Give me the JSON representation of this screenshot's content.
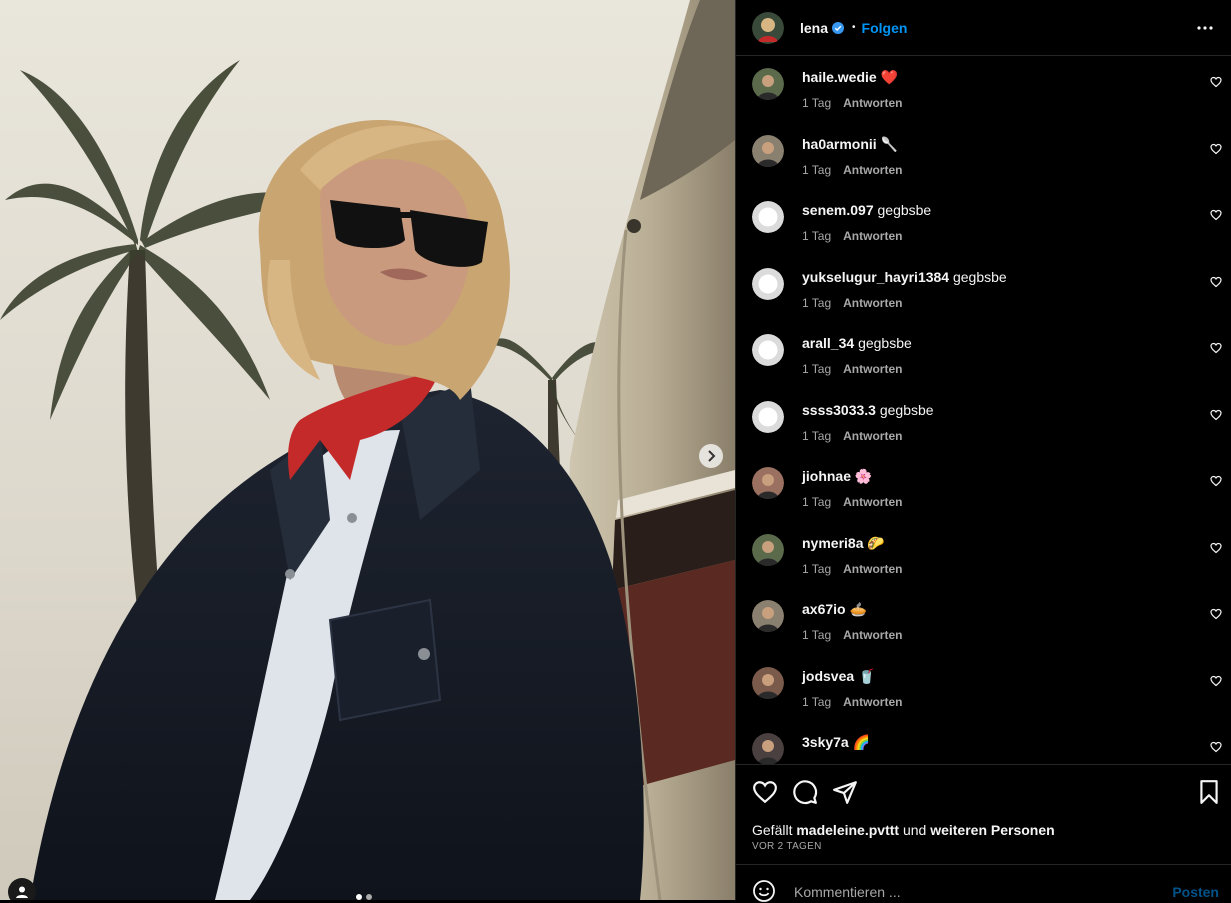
{
  "post": {
    "username": "lena",
    "separator": "•",
    "follow_label": "Folgen",
    "photo_alt": "",
    "verified_color": "#3897f0"
  },
  "comments": [
    {
      "user": "haile.wedie",
      "text": "❤️",
      "time": "1 Tag",
      "reply": "Antworten",
      "avatar": "photo"
    },
    {
      "user": "ha0armonii",
      "text": "🥄",
      "time": "1 Tag",
      "reply": "Antworten",
      "avatar": "photo"
    },
    {
      "user": "senem.097",
      "text": "gegbsbe",
      "time": "1 Tag",
      "reply": "Antworten",
      "avatar": "default"
    },
    {
      "user": "yukselugur_hayri1384",
      "text": "gegbsbe",
      "time": "1 Tag",
      "reply": "Antworten",
      "avatar": "default"
    },
    {
      "user": "arall_34",
      "text": "gegbsbe",
      "time": "1 Tag",
      "reply": "Antworten",
      "avatar": "default"
    },
    {
      "user": "ssss3033.3",
      "text": "gegbsbe",
      "time": "1 Tag",
      "reply": "Antworten",
      "avatar": "default"
    },
    {
      "user": "jiohnae",
      "text": "🌸",
      "time": "1 Tag",
      "reply": "Antworten",
      "avatar": "photo"
    },
    {
      "user": "nymeri8a",
      "text": "🌮",
      "time": "1 Tag",
      "reply": "Antworten",
      "avatar": "photo"
    },
    {
      "user": "ax67io",
      "text": "🥧",
      "time": "1 Tag",
      "reply": "Antworten",
      "avatar": "photo"
    },
    {
      "user": "jodsvea",
      "text": "🥤",
      "time": "1 Tag",
      "reply": "Antworten",
      "avatar": "photo"
    },
    {
      "user": "3sky7a",
      "text": "🌈",
      "time": "",
      "reply": "",
      "avatar": "photo"
    }
  ],
  "likes": {
    "prefix": "Gefällt",
    "user": "madeleine.pvttt",
    "middle": "und",
    "others": "weiteren Personen"
  },
  "date": "VOR 2 TAGEN",
  "composer": {
    "placeholder": "Kommentieren ...",
    "post_label": "Posten"
  },
  "colors": {
    "accent": "#0095f6",
    "background": "#000000",
    "secondary_text": "#a8a8a8"
  },
  "icons": {
    "like": "heart-icon",
    "comment": "comment-icon",
    "share": "paper-plane-icon",
    "save": "bookmark-icon",
    "more": "more-options-icon",
    "emoji": "emoji-icon",
    "next": "chevron-right-icon",
    "tag": "user-tag-icon"
  }
}
